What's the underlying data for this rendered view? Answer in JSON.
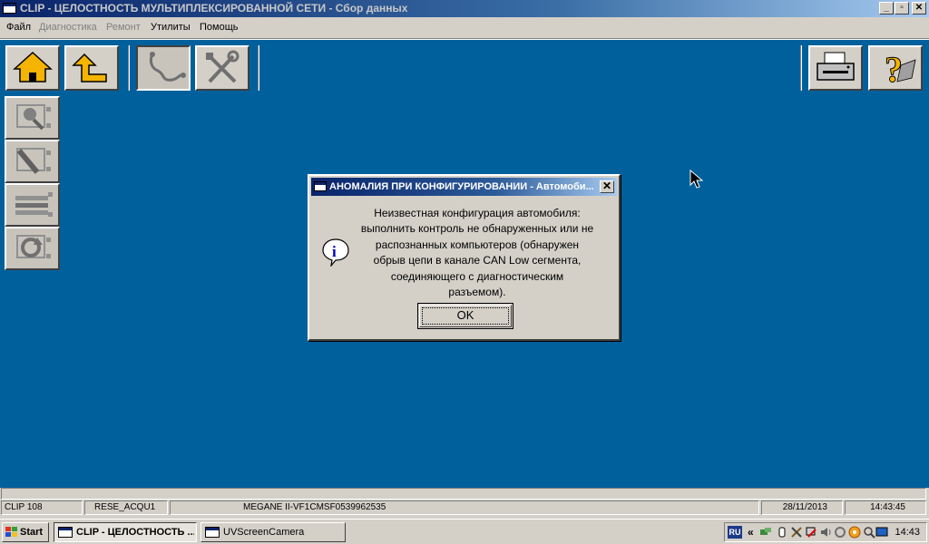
{
  "window": {
    "title": "CLIP - ЦЕЛОСТНОСТЬ МУЛЬТИПЛЕКСИРОВАННОЙ СЕТИ - Сбор данных",
    "btn_minimize": "_",
    "btn_restore": "▫",
    "btn_close": "✕"
  },
  "menu": {
    "file": "Файл",
    "diagnostics": "Диагностика",
    "repair": "Ремонт",
    "utilities": "Утилиты",
    "help": "Помощь"
  },
  "toolbar": {
    "icons": [
      "home-icon",
      "up-arrow-icon",
      "stethoscope-icon",
      "tools-icon",
      "printer-icon",
      "help-icon"
    ]
  },
  "dialog": {
    "title": "АНОМАЛИЯ ПРИ КОНФИГУРИРОВАНИИ - Автомоби...",
    "close_label": "✕",
    "message_lines": [
      "Неизвестная конфигурация автомобиля:",
      "выполнить контроль не обнаруженных или не",
      "распознанных компьютеров (обнаружен",
      "обрыв цепи в канале CAN Low сегмента,",
      "соединяющего с диагностическим",
      "разъемом)."
    ],
    "ok_label": "OK"
  },
  "status": {
    "clip": "CLIP 108",
    "mode": "RESE_ACQU1",
    "vehicle": "MEGANE II-VF1CMSF0539962535",
    "date": "28/11/2013",
    "time": "14:43:45"
  },
  "taskbar": {
    "start_label": "Start",
    "tasks": [
      {
        "label": "CLIP - ЦЕЛОСТНОСТЬ ..."
      },
      {
        "label": "UVScreenCamera"
      }
    ],
    "lang": "RU",
    "chevron": "«",
    "clock": "14:43"
  }
}
